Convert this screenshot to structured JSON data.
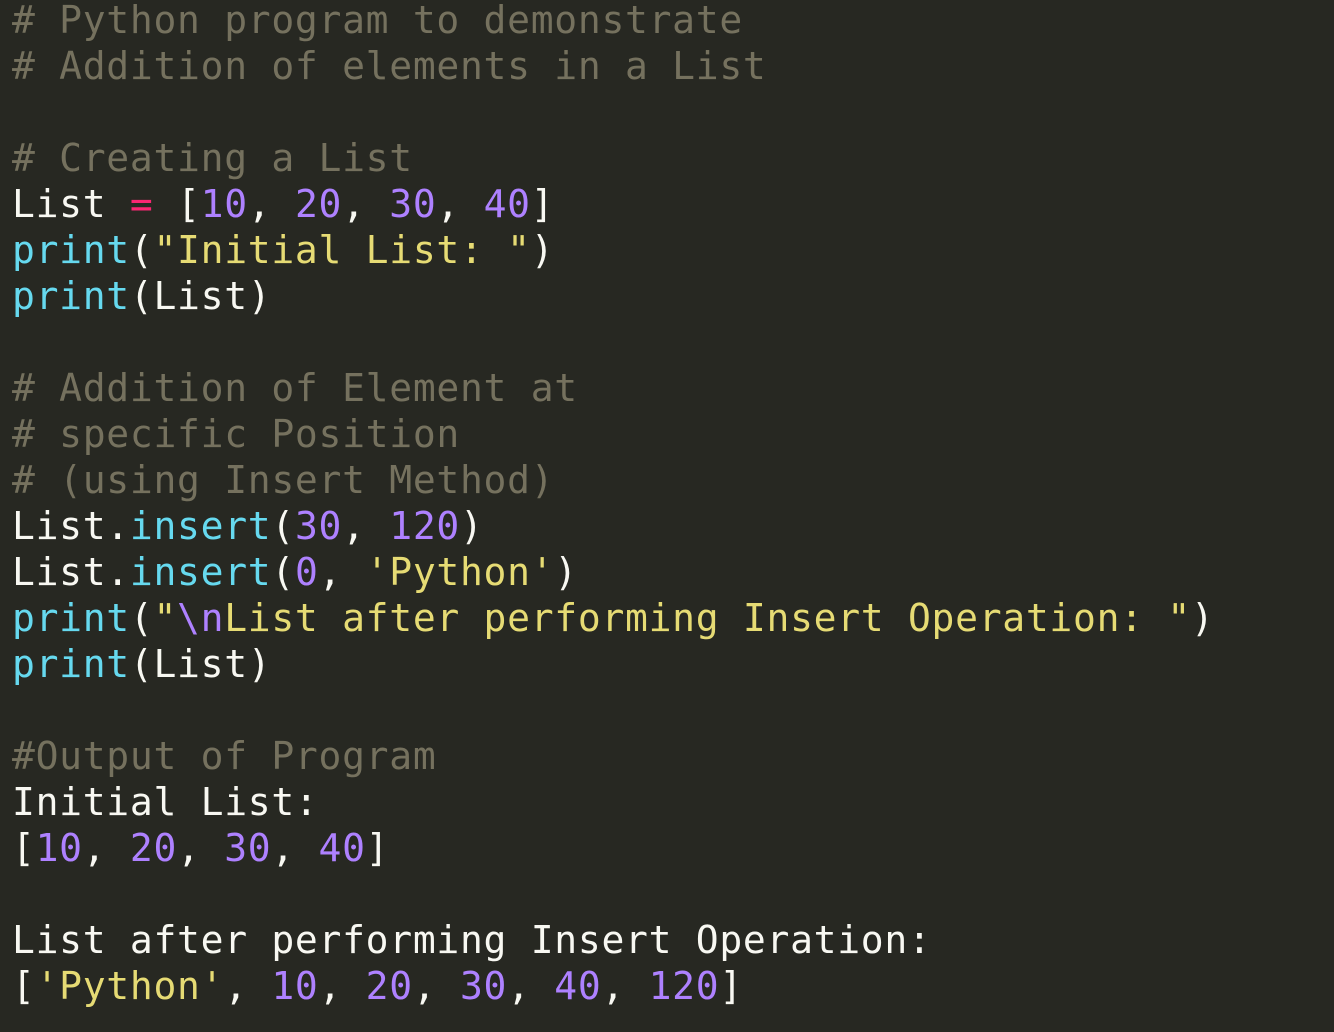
{
  "editor": {
    "background": "#272822",
    "theme_colors": {
      "comment": "#75715e",
      "plain": "#f8f8f2",
      "operator": "#f92672",
      "number": "#ae81ff",
      "string": "#e6db74",
      "function": "#66d9ef"
    },
    "lines": [
      [
        {
          "t": "comment",
          "v": "# Python program to demonstrate"
        }
      ],
      [
        {
          "t": "comment",
          "v": "# Addition of elements in a List"
        }
      ],
      [],
      [
        {
          "t": "comment",
          "v": "# Creating a List"
        }
      ],
      [
        {
          "t": "plain",
          "v": "List "
        },
        {
          "t": "operator",
          "v": "="
        },
        {
          "t": "plain",
          "v": " ["
        },
        {
          "t": "number",
          "v": "10"
        },
        {
          "t": "plain",
          "v": ", "
        },
        {
          "t": "number",
          "v": "20"
        },
        {
          "t": "plain",
          "v": ", "
        },
        {
          "t": "number",
          "v": "30"
        },
        {
          "t": "plain",
          "v": ", "
        },
        {
          "t": "number",
          "v": "40"
        },
        {
          "t": "plain",
          "v": "]"
        }
      ],
      [
        {
          "t": "function",
          "v": "print"
        },
        {
          "t": "plain",
          "v": "("
        },
        {
          "t": "string",
          "v": "\"Initial List: \""
        },
        {
          "t": "plain",
          "v": ")"
        }
      ],
      [
        {
          "t": "function",
          "v": "print"
        },
        {
          "t": "plain",
          "v": "(List)"
        }
      ],
      [],
      [
        {
          "t": "comment",
          "v": "# Addition of Element at"
        }
      ],
      [
        {
          "t": "comment",
          "v": "# specific Position"
        }
      ],
      [
        {
          "t": "comment",
          "v": "# (using Insert Method)"
        }
      ],
      [
        {
          "t": "plain",
          "v": "List."
        },
        {
          "t": "method",
          "v": "insert"
        },
        {
          "t": "plain",
          "v": "("
        },
        {
          "t": "number",
          "v": "30"
        },
        {
          "t": "plain",
          "v": ", "
        },
        {
          "t": "number",
          "v": "120"
        },
        {
          "t": "plain",
          "v": ")"
        }
      ],
      [
        {
          "t": "plain",
          "v": "List."
        },
        {
          "t": "method",
          "v": "insert"
        },
        {
          "t": "plain",
          "v": "("
        },
        {
          "t": "number",
          "v": "0"
        },
        {
          "t": "plain",
          "v": ", "
        },
        {
          "t": "string",
          "v": "'Python'"
        },
        {
          "t": "plain",
          "v": ")"
        }
      ],
      [
        {
          "t": "function",
          "v": "print"
        },
        {
          "t": "plain",
          "v": "("
        },
        {
          "t": "string",
          "v": "\""
        },
        {
          "t": "escape",
          "v": "\\n"
        },
        {
          "t": "string",
          "v": "List after performing Insert Operation: \""
        },
        {
          "t": "plain",
          "v": ")"
        }
      ],
      [
        {
          "t": "function",
          "v": "print"
        },
        {
          "t": "plain",
          "v": "(List)"
        }
      ],
      [],
      [
        {
          "t": "comment",
          "v": "#Output of Program"
        }
      ],
      [
        {
          "t": "plain",
          "v": "Initial List:"
        }
      ],
      [
        {
          "t": "plain",
          "v": "["
        },
        {
          "t": "number",
          "v": "10"
        },
        {
          "t": "plain",
          "v": ", "
        },
        {
          "t": "number",
          "v": "20"
        },
        {
          "t": "plain",
          "v": ", "
        },
        {
          "t": "number",
          "v": "30"
        },
        {
          "t": "plain",
          "v": ", "
        },
        {
          "t": "number",
          "v": "40"
        },
        {
          "t": "plain",
          "v": "]"
        }
      ],
      [],
      [
        {
          "t": "plain",
          "v": "List after performing Insert Operation:"
        }
      ],
      [
        {
          "t": "plain",
          "v": "["
        },
        {
          "t": "string",
          "v": "'Python'"
        },
        {
          "t": "plain",
          "v": ", "
        },
        {
          "t": "number",
          "v": "10"
        },
        {
          "t": "plain",
          "v": ", "
        },
        {
          "t": "number",
          "v": "20"
        },
        {
          "t": "plain",
          "v": ", "
        },
        {
          "t": "number",
          "v": "30"
        },
        {
          "t": "plain",
          "v": ", "
        },
        {
          "t": "number",
          "v": "40"
        },
        {
          "t": "plain",
          "v": ", "
        },
        {
          "t": "number",
          "v": "120"
        },
        {
          "t": "plain",
          "v": "]"
        }
      ]
    ]
  }
}
